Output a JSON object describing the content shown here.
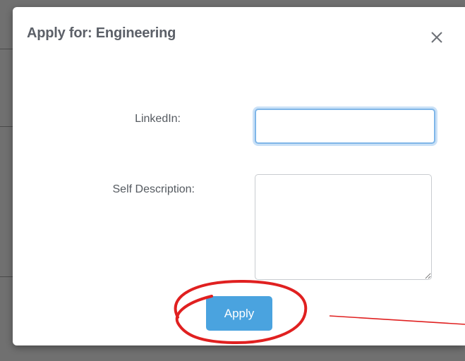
{
  "modal": {
    "title": "Apply for: Engineering",
    "close_icon": "close-icon"
  },
  "form": {
    "linkedin_label": "LinkedIn:",
    "linkedin_value": "",
    "linkedin_placeholder": "",
    "description_label": "Self Description:",
    "description_value": "",
    "description_placeholder": ""
  },
  "actions": {
    "apply_label": "Apply"
  },
  "colors": {
    "apply_button": "#4aa3df",
    "focus_ring": "#7fb6e8",
    "annotation": "#e02020",
    "overlay": "#707070"
  }
}
